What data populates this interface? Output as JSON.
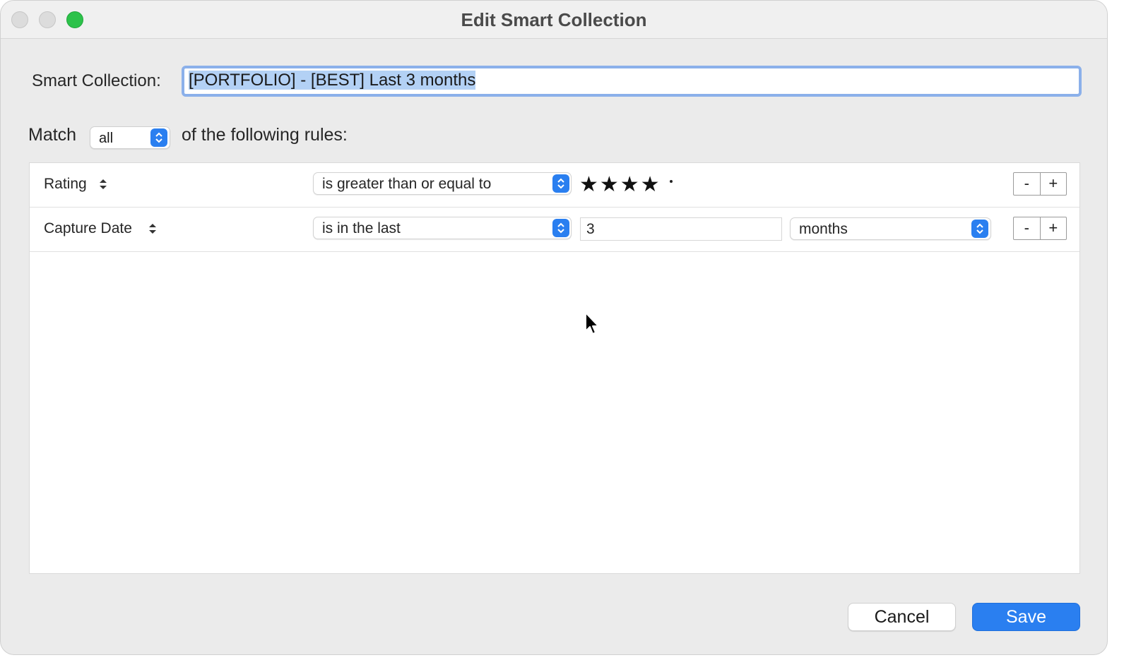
{
  "window": {
    "title": "Edit Smart Collection"
  },
  "name_field": {
    "label": "Smart Collection:",
    "value": "[PORTFOLIO] - [BEST] Last 3 months"
  },
  "match": {
    "prefix": "Match",
    "selected": "all",
    "suffix": "of the following rules:"
  },
  "rules": [
    {
      "field": "Rating",
      "operator": "is greater than or equal to",
      "stars": "★★★★",
      "rating_value": 4,
      "rating_max": 5
    },
    {
      "field": "Capture Date",
      "operator": "is in the last",
      "number": "3",
      "unit": "months"
    }
  ],
  "row_buttons": {
    "remove": "-",
    "add": "+"
  },
  "footer": {
    "cancel_label": "Cancel",
    "save_label": "Save"
  },
  "colors": {
    "accent": "#2a7ff0",
    "selection": "#b3d1f5",
    "focus_ring": "#8bb0ea",
    "zoom_button": "#2cc24a"
  }
}
